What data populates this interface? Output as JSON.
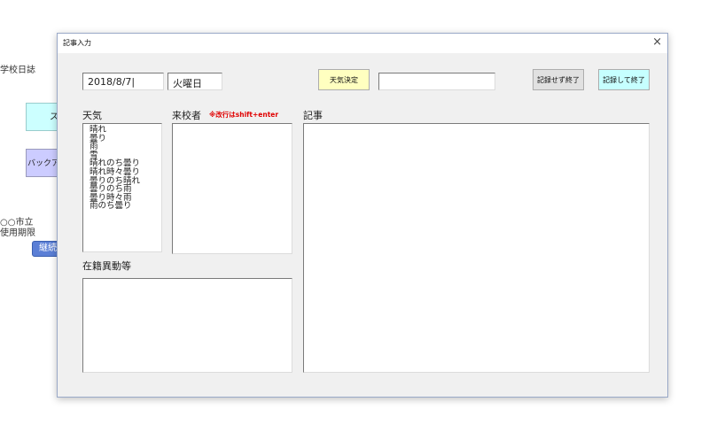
{
  "background": {
    "app_title_fragment": "学校日誌",
    "cyan_button_fragment": "ス",
    "purple_button_fragment": "バックア",
    "footer_line1_fragment": "○○市立",
    "footer_line2_fragment": "使用期限",
    "blue_button_fragment": "継続"
  },
  "dialog": {
    "title": "記事入力",
    "close_glyph": "×",
    "date_value": "2018/8/7|",
    "weekday_value": "火曜日",
    "weather_decide_label": "天気決定",
    "weather_result_value": "",
    "close_no_record_label": "記録せず終了",
    "close_record_label": "記録して終了",
    "weather_label": "天気",
    "visitor_label": "来校者",
    "visitor_note": "※改行はshift+enter",
    "article_label": "記事",
    "enrollment_label": "在籍異動等",
    "weather_options": [
      "晴れ",
      "曇り",
      "雨",
      "雪",
      "晴れのち曇り",
      "晴れ時々曇り",
      "曇りのち晴れ",
      "曇りのち雨",
      "曇り時々雨",
      "雨のち曇り"
    ],
    "visitor_value": "",
    "article_value": "",
    "enrollment_value": ""
  }
}
